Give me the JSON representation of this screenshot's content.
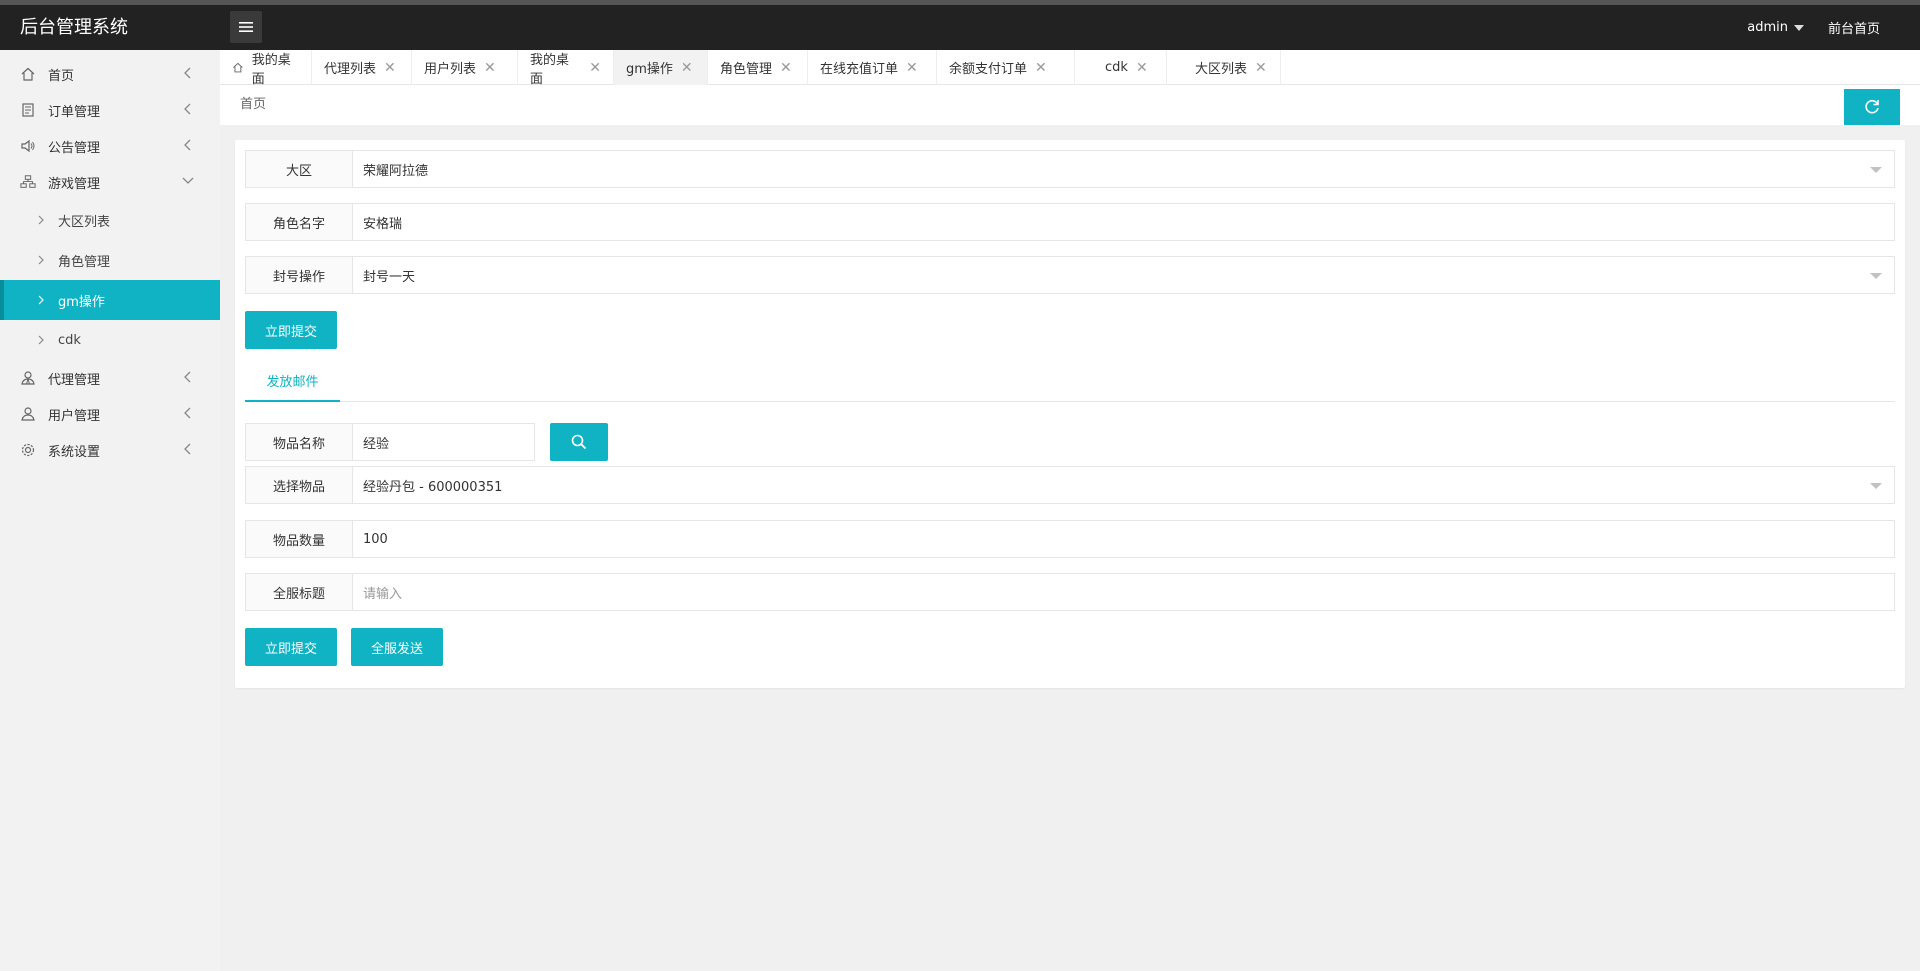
{
  "header": {
    "title": "后台管理系统",
    "user": "admin",
    "front_link": "前台首页"
  },
  "sidebar": {
    "items": [
      {
        "label": "首页",
        "icon": "home-icon"
      },
      {
        "label": "订单管理",
        "icon": "order-icon"
      },
      {
        "label": "公告管理",
        "icon": "speaker-icon"
      },
      {
        "label": "游戏管理",
        "icon": "sitemap-icon"
      },
      {
        "label": "代理管理",
        "icon": "agent-icon"
      },
      {
        "label": "用户管理",
        "icon": "user-icon"
      },
      {
        "label": "系统设置",
        "icon": "gear-icon"
      }
    ],
    "game_sub": [
      "大区列表",
      "角色管理",
      "gm操作",
      "cdk"
    ]
  },
  "tabs": [
    {
      "label": "我的桌面"
    },
    {
      "label": "代理列表"
    },
    {
      "label": "用户列表"
    },
    {
      "label": "我的桌面"
    },
    {
      "label": "gm操作"
    },
    {
      "label": "角色管理"
    },
    {
      "label": "在线充值订单"
    },
    {
      "label": "余额支付订单"
    },
    {
      "label": "cdk"
    },
    {
      "label": "大区列表"
    }
  ],
  "breadcrumb": "首页",
  "ban_form": {
    "region_label": "大区",
    "region_value": "荣耀阿拉德",
    "role_label": "角色名字",
    "role_value": "安格瑞",
    "ban_label": "封号操作",
    "ban_value": "封号一天",
    "submit": "立即提交"
  },
  "mail_tab": "发放邮件",
  "mail_form": {
    "item_name_label": "物品名称",
    "item_name_value": "经验",
    "select_label": "选择物品",
    "select_value": "经验丹包 - 600000351",
    "qty_label": "物品数量",
    "qty_value": "100",
    "title_label": "全服标题",
    "title_placeholder": "请输入",
    "submit": "立即提交",
    "send_all": "全服发送"
  },
  "colors": {
    "accent": "#0fb3c3",
    "header": "#222222"
  }
}
